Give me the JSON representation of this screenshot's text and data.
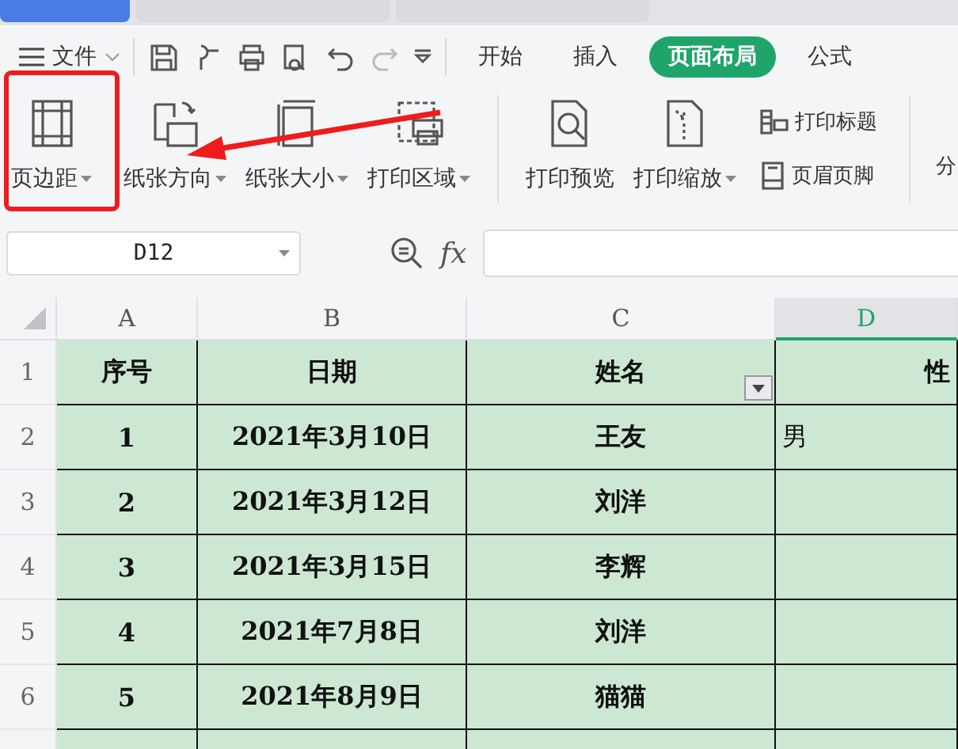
{
  "tabs": [
    {
      "selected": true
    },
    {
      "selected": false
    },
    {
      "selected": false
    }
  ],
  "menu": {
    "file": "文件",
    "ribbon_tabs": [
      {
        "label": "开始",
        "selected": false
      },
      {
        "label": "插入",
        "selected": false
      },
      {
        "label": "页面布局",
        "selected": true
      },
      {
        "label": "公式",
        "selected": false
      }
    ]
  },
  "ribbon": {
    "large": [
      {
        "label": "页边距",
        "dropdown": true
      },
      {
        "label": "纸张方向",
        "dropdown": true
      },
      {
        "label": "纸张大小",
        "dropdown": true
      },
      {
        "label": "打印区域",
        "dropdown": true
      },
      {
        "label": "打印预览",
        "dropdown": false
      },
      {
        "label": "打印缩放",
        "dropdown": true
      }
    ],
    "small": [
      "打印标题",
      "页眉页脚"
    ],
    "cut_off": "分"
  },
  "formula_bar": {
    "cell_ref": "D12",
    "fx": "fx"
  },
  "columns": [
    {
      "label": "A",
      "selected": false
    },
    {
      "label": "B",
      "selected": false
    },
    {
      "label": "C",
      "selected": false
    },
    {
      "label": "D",
      "selected": true
    }
  ],
  "rows": [
    {
      "number": "1",
      "cells": [
        "序号",
        "日期",
        "姓名",
        "性"
      ],
      "filter": true
    },
    {
      "number": "2",
      "cells": [
        "1",
        "2021年3月10日",
        "王友",
        "男"
      ]
    },
    {
      "number": "3",
      "cells": [
        "2",
        "2021年3月12日",
        "刘洋"
      ]
    },
    {
      "number": "4",
      "cells": [
        "3",
        "2021年3月15日",
        "李辉"
      ]
    },
    {
      "number": "5",
      "cells": [
        "4",
        "2021年7月8日",
        "刘洋"
      ]
    },
    {
      "number": "6",
      "cells": [
        "5",
        "2021年8月9日",
        "猫猫"
      ]
    }
  ]
}
